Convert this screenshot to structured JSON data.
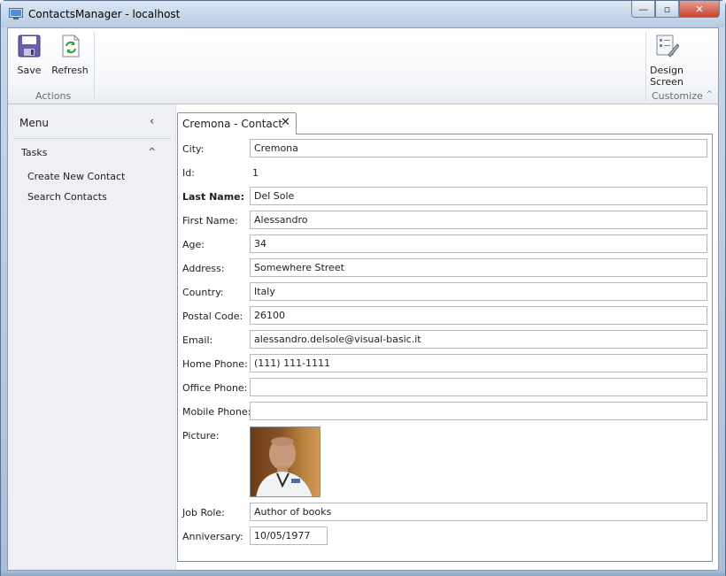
{
  "window": {
    "title": "ContactsManager - localhost",
    "minimize_glyph": "—",
    "maximize_glyph": "▫",
    "close_glyph": "✕"
  },
  "ribbon": {
    "save_label": "Save",
    "refresh_label": "Refresh",
    "actions_group": "Actions",
    "design_screen_line1": "Design",
    "design_screen_line2": "Screen",
    "customize_group": "Customize",
    "collapse_glyph": "^"
  },
  "menu": {
    "header": "Menu",
    "collapse_glyph": "‹",
    "tasks_header": "Tasks",
    "tasks_glyph": "^",
    "items": [
      {
        "label": "Create New Contact"
      },
      {
        "label": "Search Contacts"
      }
    ]
  },
  "tab": {
    "label": "Cremona - Contact",
    "close_glyph": "✕"
  },
  "form": {
    "city": {
      "label": "City:",
      "value": "Cremona"
    },
    "id": {
      "label": "Id:",
      "value": "1"
    },
    "last_name": {
      "label": "Last Name:",
      "value": "Del Sole"
    },
    "first_name": {
      "label": "First Name:",
      "value": "Alessandro"
    },
    "age": {
      "label": "Age:",
      "value": "34"
    },
    "address": {
      "label": "Address:",
      "value": "Somewhere Street"
    },
    "country": {
      "label": "Country:",
      "value": "Italy"
    },
    "postal_code": {
      "label": "Postal Code:",
      "value": "26100"
    },
    "email": {
      "label": "Email:",
      "value": "alessandro.delsole@visual-basic.it"
    },
    "home_phone": {
      "label": "Home Phone:",
      "value": "(111) 111-1111"
    },
    "office_phone": {
      "label": "Office Phone:",
      "value": ""
    },
    "mobile_phone": {
      "label": "Mobile Phone:",
      "value": ""
    },
    "picture": {
      "label": "Picture:"
    },
    "job_role": {
      "label": "Job Role:",
      "value": "Author of books"
    },
    "anniversary": {
      "label": "Anniversary:",
      "value": "10/05/1977"
    }
  },
  "colors": {
    "accent_blue": "#5b7fb2",
    "save_icon": "#6a5fa8",
    "refresh_icon": "#2f9a3a"
  }
}
